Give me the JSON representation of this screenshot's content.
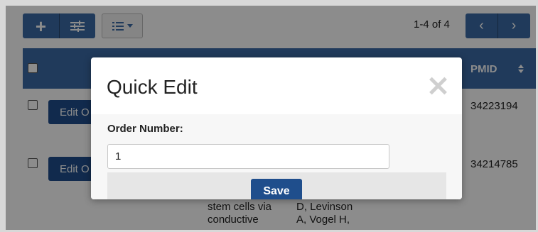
{
  "toolbar": {
    "add_icon": "plus-icon",
    "filter_icon": "sliders-icon",
    "view_icon": "list-icon",
    "pagination_text": "1-4 of 4",
    "prev_icon": "chevron-left-icon",
    "next_icon": "chevron-right-icon"
  },
  "table": {
    "header": {
      "pmid": "PMID"
    },
    "rows": [
      {
        "edit_label": "Edit O",
        "pmid": "34223194"
      },
      {
        "edit_label": "Edit O",
        "pmid": "34214785"
      }
    ],
    "bottom_cells": {
      "col_a": [
        "stem cells via",
        "conductive"
      ],
      "col_b": [
        "D, Levinson",
        "A, Vogel H,"
      ]
    }
  },
  "modal": {
    "title": "Quick Edit",
    "close_icon": "close-icon",
    "field_label": "Order Number:",
    "field_value": "1",
    "save_label": "Save"
  },
  "colors": {
    "primary": "#3b6ba6",
    "primary_dark": "#1f4e8c"
  }
}
